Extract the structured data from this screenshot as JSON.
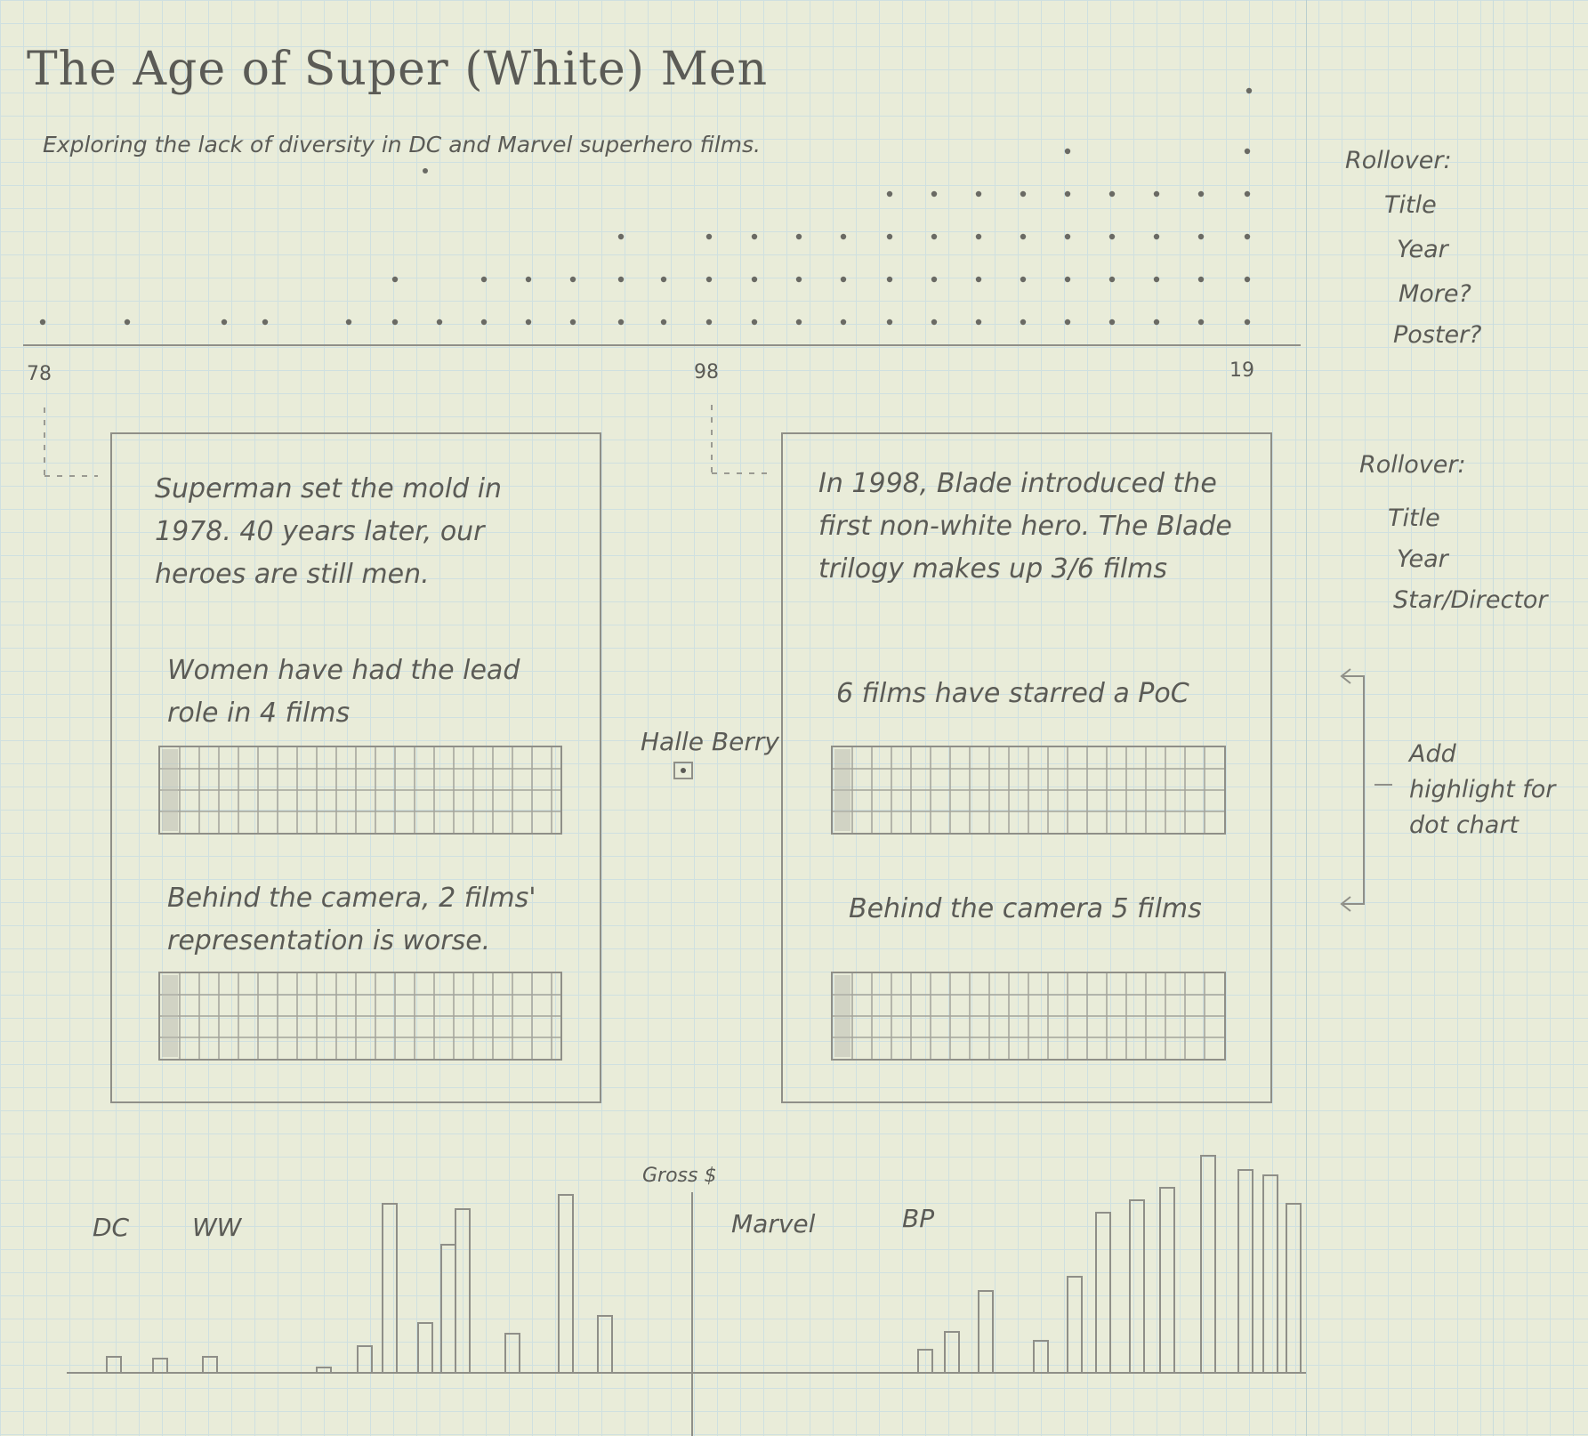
{
  "title": "The Age of Super (White) Men",
  "subtitle": "Exploring the lack of diversity in DC and Marvel superhero films.",
  "dot_axis": {
    "start": "78",
    "mid": "98",
    "end": "19"
  },
  "rollover_top": {
    "heading": "Rollover:",
    "items": [
      "Title",
      "Year",
      "More?",
      "Poster?"
    ]
  },
  "rollover_mid": {
    "heading": "Rollover:",
    "items": [
      "Title",
      "Year",
      "Star/Director"
    ]
  },
  "add_highlight": "Add highlight for dot chart",
  "left_card": {
    "intro": "Superman set the mold in 1978. 40 years later, our heroes are still men.",
    "lead_stat": "Women have had the lead role in 4 films",
    "camera_stat": "Behind the camera, 2 films' representation is worse."
  },
  "right_card": {
    "intro": "In 1998, Blade introduced the first non-white hero. The Blade trilogy makes up 3/6 films",
    "lead_stat": "6 films have starred a PoC",
    "camera_stat": "Behind the camera 5 films"
  },
  "halle_label": "Halle Berry",
  "bottom": {
    "gross_label": "Gross $",
    "dc_label": "DC",
    "ww_label": "WW",
    "marvel_label": "Marvel",
    "bp_label": "BP"
  }
}
